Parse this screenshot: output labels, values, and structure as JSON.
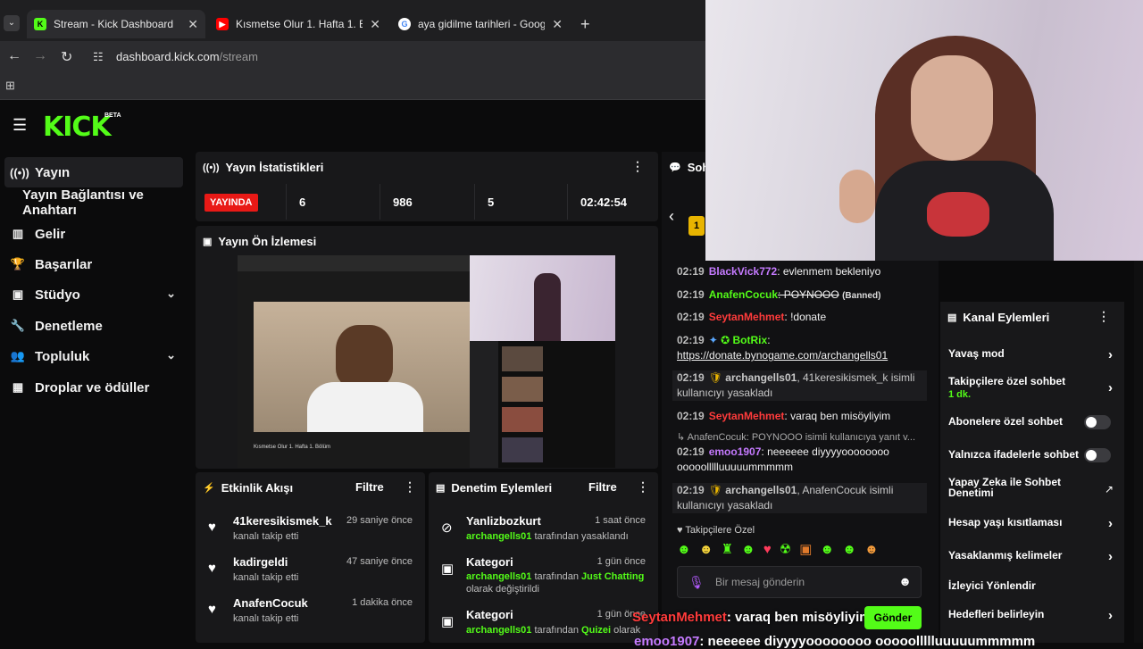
{
  "browser": {
    "tabs": [
      {
        "title": "Stream - Kick Dashboard",
        "icon": "kick-favicon",
        "active": true
      },
      {
        "title": "Kısmetse Olur 1. Hafta 1. Bölüm",
        "icon": "youtube-favicon",
        "active": false
      },
      {
        "title": "aya gidilme tarihleri - Google'da",
        "icon": "google-favicon",
        "active": false
      }
    ],
    "url_host": "dashboard.kick.com",
    "url_path": "/stream"
  },
  "header": {
    "logo": "KICK",
    "beta": "BETA"
  },
  "sidebar": {
    "items": [
      {
        "label": "Yayın",
        "icon": "broadcast-icon",
        "active": true
      },
      {
        "label": "Yayın Bağlantısı ve Anahtarı",
        "icon": "",
        "active": false
      },
      {
        "label": "Gelir",
        "icon": "chart-icon",
        "active": false
      },
      {
        "label": "Başarılar",
        "icon": "trophy-icon",
        "active": false
      },
      {
        "label": "Stüdyo",
        "icon": "studio-icon",
        "active": false,
        "expandable": true
      },
      {
        "label": "Denetleme",
        "icon": "wrench-icon",
        "active": false
      },
      {
        "label": "Topluluk",
        "icon": "community-icon",
        "active": false,
        "expandable": true
      },
      {
        "label": "Droplar ve ödüller",
        "icon": "drops-icon",
        "active": false
      }
    ]
  },
  "stats": {
    "title": "Yayın İstatistikleri",
    "live_label": "YAYINDA",
    "values": [
      "6",
      "986",
      "5",
      "02:42:54"
    ]
  },
  "preview": {
    "title": "Yayın Ön İzlemesi",
    "video_caption": "Kısmetse Olur 1. Hafta 1. Bölüm"
  },
  "activity": {
    "title": "Etkinlik Akışı",
    "filter": "Filtre",
    "events": [
      {
        "name": "41keresikismek_k",
        "action": "kanalı takip etti",
        "time": "29 saniye önce"
      },
      {
        "name": "kadirgeldi",
        "action": "kanalı takip etti",
        "time": "47 saniye önce"
      },
      {
        "name": "AnafenCocuk",
        "action": "kanalı takip etti",
        "time": "1 dakika önce"
      }
    ]
  },
  "moderation": {
    "title": "Denetim Eylemleri",
    "filter": "Filtre",
    "events": [
      {
        "name": "Yanlizbozkurt",
        "by": "archangells01",
        "action": "tarafından yasaklandı",
        "time": "1 saat önce",
        "icon": "ban-icon"
      },
      {
        "name": "Kategori",
        "by": "archangells01",
        "action_pre": "tarafından",
        "target": "Just Chatting",
        "action": "olarak değiştirildi",
        "time": "1 gün önce",
        "icon": "category-icon"
      },
      {
        "name": "Kategori",
        "by": "archangells01",
        "action_pre": "tarafından",
        "target": "Quizei",
        "action": "olarak",
        "time": "1 gün önce",
        "icon": "category-icon"
      }
    ]
  },
  "chat": {
    "title": "Soh",
    "messages": [
      {
        "time": "02:19",
        "user": "BlackVick772",
        "color": "#c57aff",
        "text": ": evlenmem bekleniyo"
      },
      {
        "time": "02:19",
        "user": "AnafenCocuk",
        "color": "#53fc18",
        "text": ": POYNOOO",
        "tag": "(Banned)"
      },
      {
        "time": "02:19",
        "user": "SeytanMehmet",
        "color": "#ff3b3b",
        "text": ": !donate"
      },
      {
        "time": "02:19",
        "user": "BotRix",
        "color": "#53fc18",
        "text": ":",
        "link": "https://donate.bynogame.com/archangells01"
      },
      {
        "time": "02:19",
        "user": "archangells01",
        "color": "#c8c8c8",
        "text": ", 41keresikismek_k isimli kullanıcıyı yasakladı",
        "system": true
      },
      {
        "time": "02:19",
        "user": "SeytanMehmet",
        "color": "#ff3b3b",
        "text": ": varaq ben misöyliyim"
      },
      {
        "reply": "AnafenCocuk: POYNOOO isimli kullanıcıya yanıt v..."
      },
      {
        "time": "02:19",
        "user": "emoo1907",
        "color": "#c57aff",
        "text": ": neeeeee diyyyyoooooooo ooooollllluuuuummmmm"
      },
      {
        "time": "02:19",
        "user": "archangells01",
        "color": "#c8c8c8",
        "text": ", AnafenCocuk isimli kullanıcıyı yasakladı",
        "system": true
      }
    ],
    "followers_only": "Takipçilere Özel",
    "emote_icons": [
      "emote-1",
      "emote-2",
      "emote-3",
      "emote-4",
      "emote-5",
      "emote-6",
      "emote-7",
      "emote-8",
      "emote-9",
      "emote-10"
    ],
    "input_placeholder": "Bir mesaj gönderin",
    "send_label": "Gönder"
  },
  "channel_actions": {
    "title": "Kanal Eylemleri",
    "items": [
      {
        "label": "Yavaş mod",
        "control": "chevron"
      },
      {
        "label": "Takipçilere özel sohbet",
        "sub": "1 dk.",
        "control": "chevron"
      },
      {
        "label": "Abonelere özel sohbet",
        "control": "toggle"
      },
      {
        "label": "Yalnızca ifadelerle sohbet",
        "control": "toggle"
      },
      {
        "label": "Yapay Zeka ile Sohbet Denetimi",
        "control": "external"
      },
      {
        "label": "Hesap yaşı kısıtlaması",
        "control": "chevron"
      },
      {
        "label": "Yasaklanmış kelimeler",
        "control": "chevron"
      },
      {
        "label": "İzleyici Yönlendir",
        "control": "none"
      },
      {
        "label": "Hedefleri belirleyin",
        "control": "chevron"
      }
    ]
  },
  "overlay": {
    "user": "SeytanMehmet",
    "text": ": varaq ben misöyliyim",
    "user2": "emoo1907",
    "text2": ": neeeeee diyyyyoooooooo ooooollllluuuuummmmm"
  },
  "colors": {
    "brand": "#53fc18",
    "live": "#e91916",
    "panel": "#18181a"
  }
}
